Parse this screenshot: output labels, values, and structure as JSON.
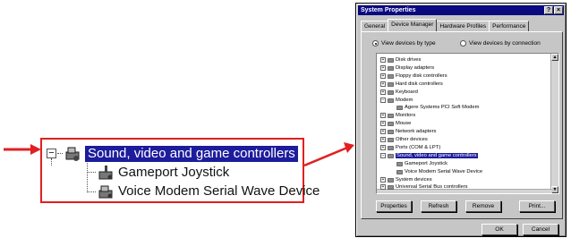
{
  "callout": {
    "expander": "−",
    "selected_label": "Sound, video and game controllers",
    "children": [
      "Gameport Joystick",
      "Voice Modem Serial Wave Device"
    ]
  },
  "dialog": {
    "title": "System Properties",
    "title_buttons": [
      "?",
      "×"
    ],
    "tabs": [
      "General",
      "Device Manager",
      "Hardware Profiles",
      "Performance"
    ],
    "active_tab": "Device Manager",
    "radio_by_type": "View devices by type",
    "radio_by_connection": "View devices by connection",
    "tree": [
      {
        "exp": "+",
        "label": "Disk drives"
      },
      {
        "exp": "+",
        "label": "Display adapters"
      },
      {
        "exp": "+",
        "label": "Floppy disk controllers"
      },
      {
        "exp": "+",
        "label": "Hard disk controllers"
      },
      {
        "exp": "+",
        "label": "Keyboard"
      },
      {
        "exp": "−",
        "label": "Modem"
      },
      {
        "exp": "",
        "label": "Agere Systems PCI Soft Modem"
      },
      {
        "exp": "+",
        "label": "Monitors"
      },
      {
        "exp": "+",
        "label": "Mouse"
      },
      {
        "exp": "+",
        "label": "Network adapters"
      },
      {
        "exp": "+",
        "label": "Other devices"
      },
      {
        "exp": "+",
        "label": "Ports (COM & LPT)"
      },
      {
        "exp": "−",
        "label": "Sound, video and game controllers"
      },
      {
        "exp": "",
        "label": "Gameport Joystick"
      },
      {
        "exp": "",
        "label": "Voice Modem Serial Wave Device"
      },
      {
        "exp": "+",
        "label": "System devices"
      },
      {
        "exp": "+",
        "label": "Universal Serial Bus controllers"
      }
    ],
    "buttons": {
      "properties": "Properties",
      "refresh": "Refresh",
      "remove": "Remove",
      "print": "Print..."
    },
    "ok": "OK",
    "cancel": "Cancel",
    "colors": {
      "title_bar": "#0a0a80",
      "selection": "#1c1c9c",
      "callout_border": "#e02020"
    }
  }
}
